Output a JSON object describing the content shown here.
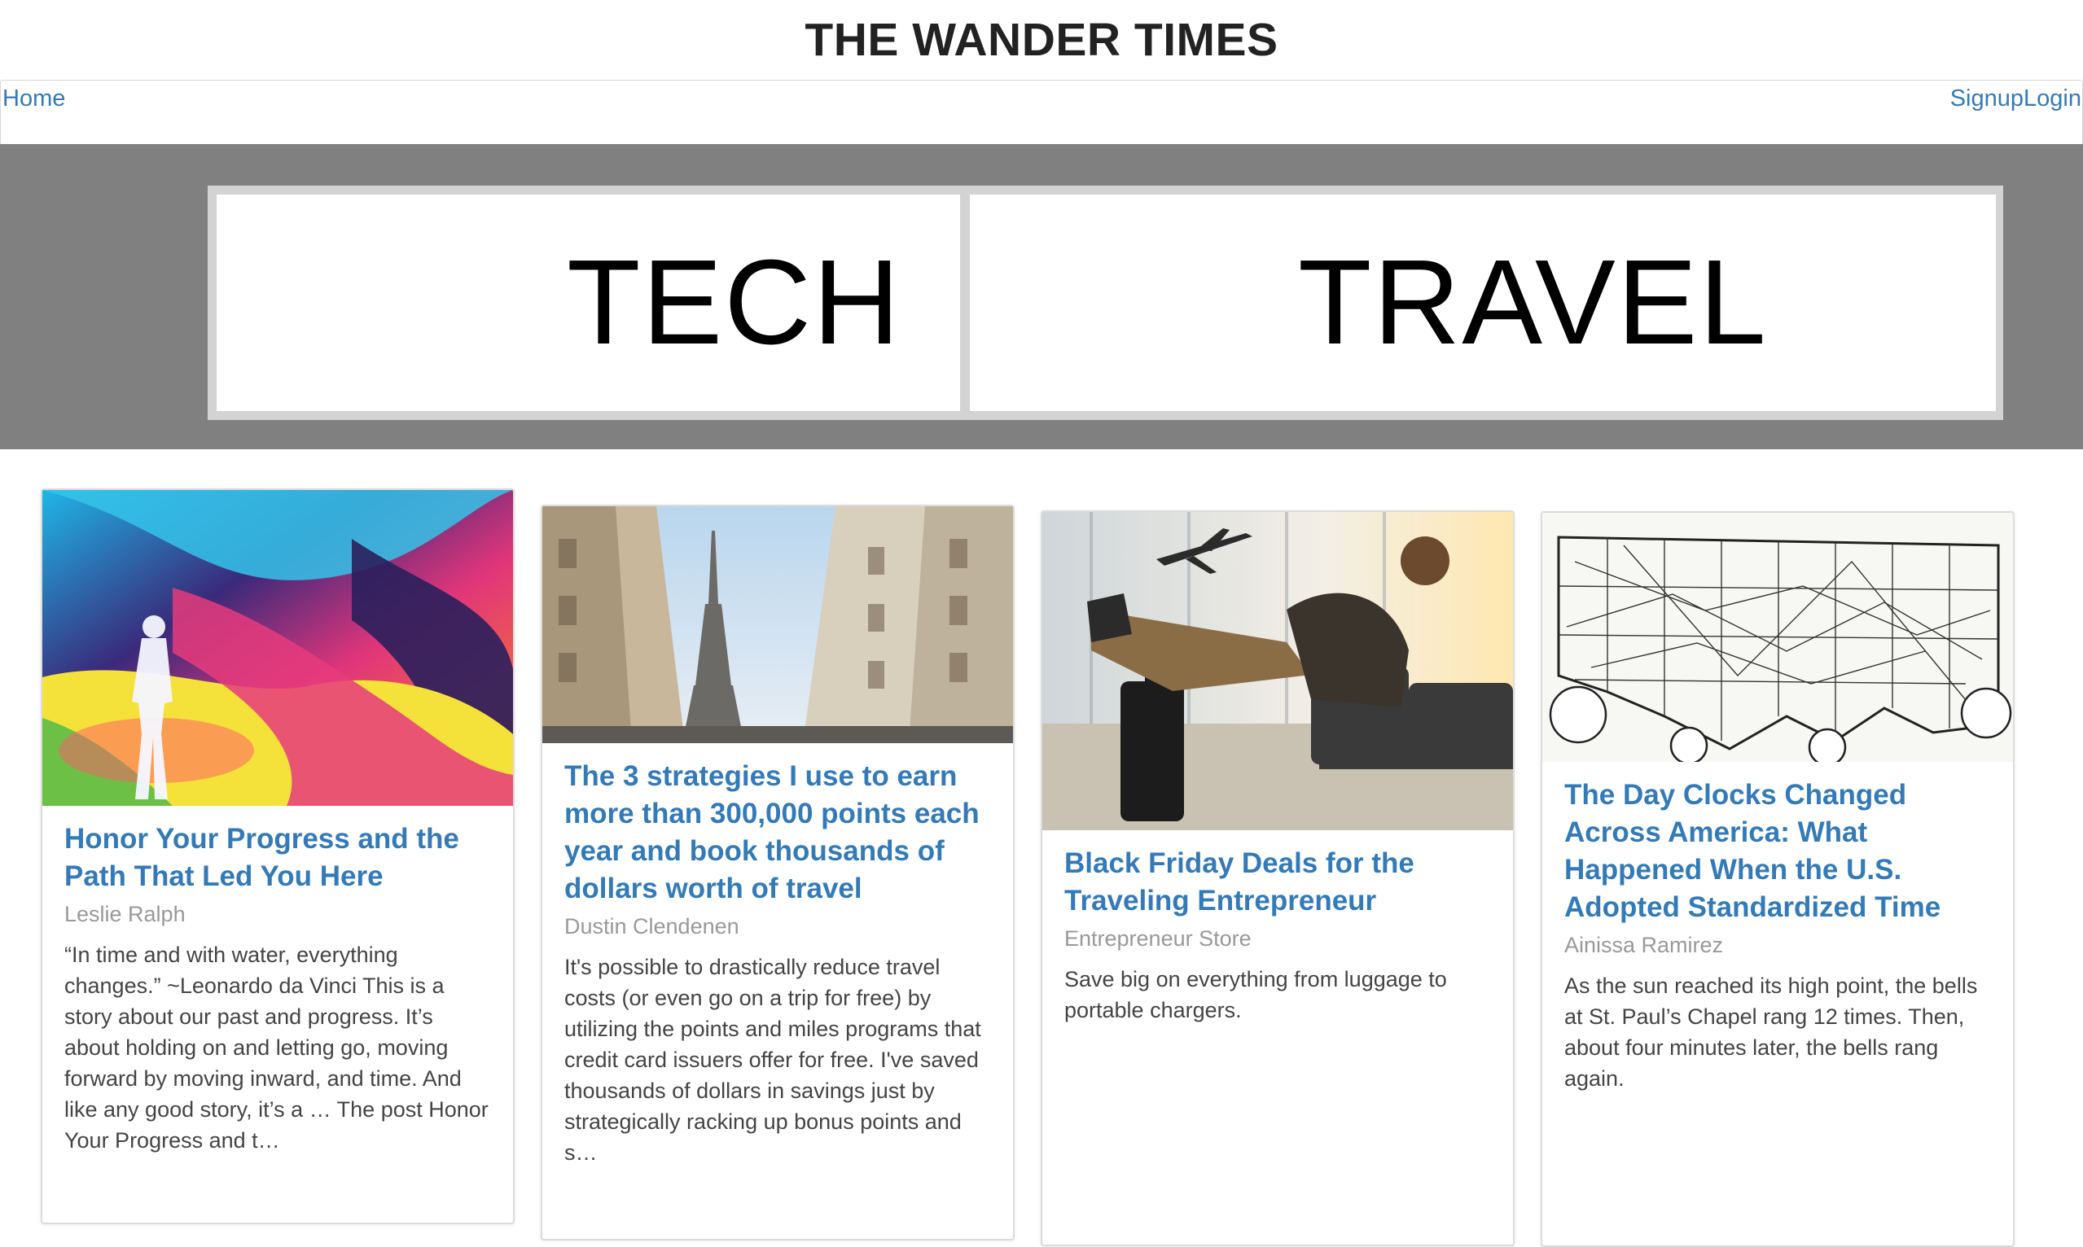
{
  "site": {
    "title": "THE WANDER TIMES"
  },
  "nav": {
    "home": "Home",
    "signup": "Signup",
    "login": "Login"
  },
  "categories": {
    "tech": "TECH",
    "travel": "TRAVEL"
  },
  "articles": [
    {
      "title": "Honor Your Progress and the Path That Led You Here",
      "author": "Leslie Ralph",
      "excerpt": "“In time and with water, everything changes.” ~Leonardo da Vinci This is a story about our past and progress. It’s about holding on and letting go, moving forward by moving inward, and time. And like any good story, it’s a … The post Honor Your Progress and t…",
      "image": "watercolor-person-illustration"
    },
    {
      "title": "The 3 strategies I use to earn more than 300,000 points each year and book thousands of dollars worth of travel",
      "author": "Dustin Clendenen",
      "excerpt": "It's possible to drastically reduce travel costs (or even go on a trip for free) by utilizing the points and miles programs that credit card issuers offer for free. I've saved thousands of dollars in savings just by strategically racking up bonus points and s…",
      "image": "paris-street-eiffel-tower-photo"
    },
    {
      "title": "Black Friday Deals for the Traveling Entrepreneur",
      "author": "Entrepreneur Store",
      "excerpt": "Save big on everything from luggage to portable chargers.",
      "image": "airport-traveler-photo"
    },
    {
      "title": "The Day Clocks Changed Across America: What Happened When the U.S. Adopted Standardized Time",
      "author": "Ainissa Ramirez",
      "excerpt": "As the sun reached its high point, the bells at St. Paul’s Chapel rang 12 times. Then, about four minutes later, the bells rang again.",
      "image": "vintage-us-time-zone-map"
    }
  ],
  "colors": {
    "link": "#337ab7",
    "band": "#808080",
    "muted": "#999999"
  }
}
